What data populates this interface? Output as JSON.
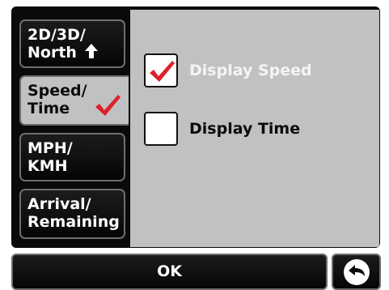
{
  "sidebar": {
    "items": [
      {
        "line1": "2D/3D/",
        "line2": "North",
        "icon": "arrow-up-icon",
        "active": false
      },
      {
        "line1": "Speed/",
        "line2": "Time",
        "icon": "checkmark-icon",
        "active": true
      },
      {
        "line1": "MPH/",
        "line2": "KMH",
        "active": false
      },
      {
        "line1": "Arrival/",
        "line2": "Remaining",
        "active": false
      }
    ]
  },
  "options": [
    {
      "label": "Display Speed",
      "checked": true
    },
    {
      "label": "Display Time",
      "checked": false
    }
  ],
  "footer": {
    "ok_label": "OK",
    "back_icon": "back-arrow-icon"
  },
  "colors": {
    "panel": "#c1c1c3",
    "button_bg": "#0a0a0a",
    "check": "#e0202a",
    "option_checked_text": "#f4f4f4",
    "option_unchecked_text": "#0b0b0b"
  }
}
